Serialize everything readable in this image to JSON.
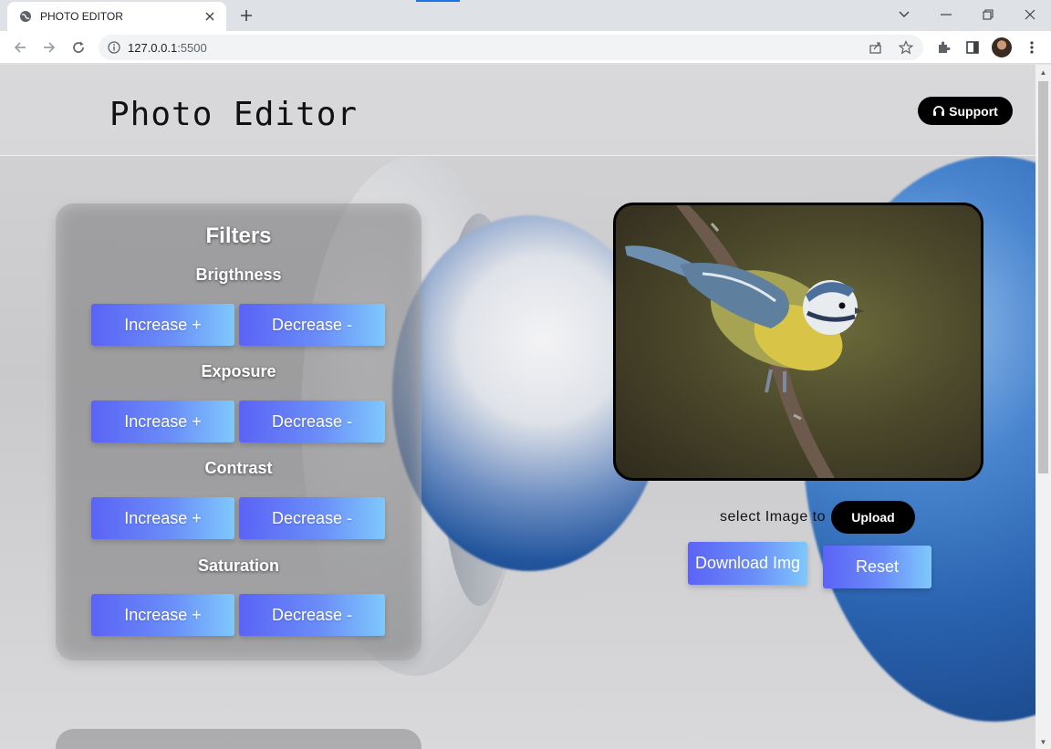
{
  "browser": {
    "tab_title": "PHOTO EDITOR",
    "url_host": "127.0.0.1",
    "url_port": ":5500"
  },
  "header": {
    "title": "Photo Editor",
    "support_label": "Support"
  },
  "filters": {
    "title": "Filters",
    "groups": [
      {
        "label": "Brigthness",
        "increase": "Increase +",
        "decrease": "Decrease -"
      },
      {
        "label": "Exposure",
        "increase": "Increase +",
        "decrease": "Decrease -"
      },
      {
        "label": "Contrast",
        "increase": "Increase +",
        "decrease": "Decrease -"
      },
      {
        "label": "Saturation",
        "increase": "Increase +",
        "decrease": "Decrease -"
      }
    ]
  },
  "editor": {
    "upload_prompt": "select Image to",
    "upload_label": "Upload",
    "download_label": "Download Img",
    "reset_label": "Reset"
  },
  "colors": {
    "button_gradient_start": "#5b63f5",
    "button_gradient_end": "#7fc8fc",
    "dark_button": "#000000"
  }
}
